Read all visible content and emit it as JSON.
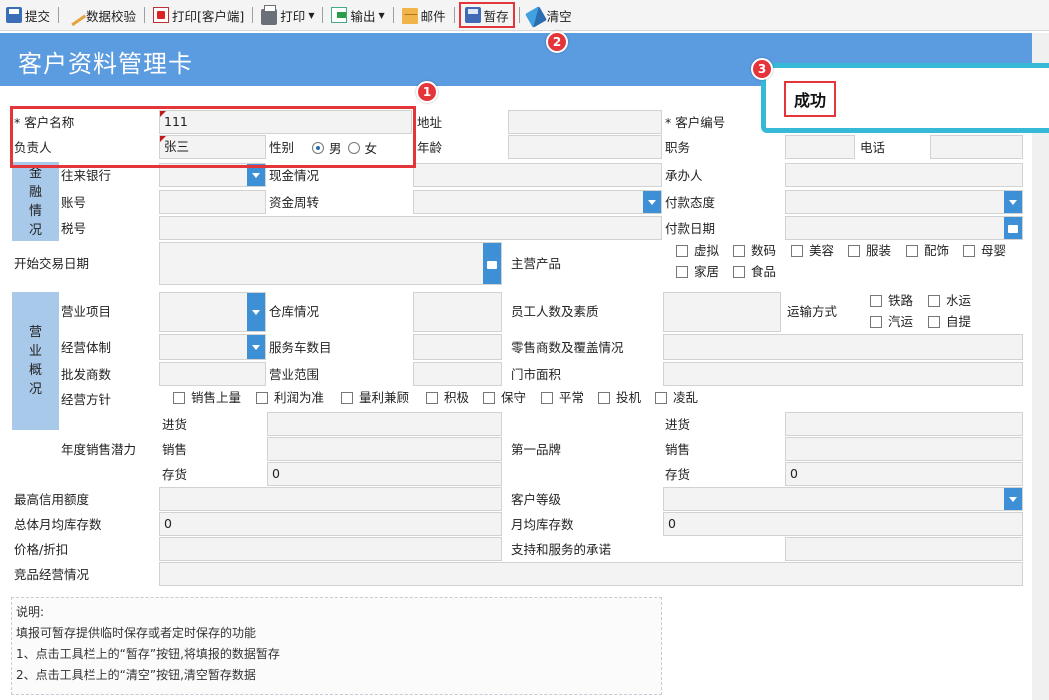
{
  "toolbar": {
    "submit": "提交",
    "validate": "数据校验",
    "print_client": "打印[客户端]",
    "print": "打印",
    "export": "输出",
    "mail": "邮件",
    "save_draft": "暂存",
    "clear": "清空"
  },
  "badges": {
    "one": "1",
    "two": "2",
    "three": "3"
  },
  "page_title": "客户资料管理卡",
  "popup": {
    "message": "成功"
  },
  "form": {
    "customer_name_label": "* 客户名称",
    "customer_name_value": "111",
    "address_label": "地址",
    "customer_code_label": "* 客户编号",
    "owner_label": "负责人",
    "owner_value": "张三",
    "gender_label": "性别",
    "gender_male": "男",
    "gender_female": "女",
    "age_label": "年龄",
    "position_label": "职务",
    "phone_label": "电话",
    "finance_section": "金融情况",
    "bank_label": "往来银行",
    "cash_label": "现金情况",
    "handler_label": "承办人",
    "account_label": "账号",
    "turnover_label": "资金周转",
    "payment_attitude_label": "付款态度",
    "tax_label": "税号",
    "payment_date_label": "付款日期",
    "start_date_label": "开始交易日期",
    "main_product_label": "主营产品",
    "products": [
      "虚拟",
      "数码",
      "美容",
      "服装",
      "配饰",
      "母婴",
      "家居",
      "食品"
    ],
    "business_section": "营业概况",
    "business_item_label": "营业项目",
    "warehouse_label": "仓库情况",
    "staff_label": "员工人数及素质",
    "transport_label": "运输方式",
    "transport": [
      "铁路",
      "水运",
      "汽运",
      "自提"
    ],
    "system_label": "经营体制",
    "vehicles_label": "服务车数目",
    "retailers_label": "零售商数及覆盖情况",
    "wholesalers_label": "批发商数",
    "scope_label": "营业范围",
    "store_area_label": "门市面积",
    "policy_label": "经营方针",
    "policies": [
      "销售上量",
      "利润为准",
      "量利兼顾",
      "积极",
      "保守",
      "平常",
      "投机",
      "凌乱"
    ],
    "annual_potential_label": "年度销售潜力",
    "purchase_label": "进货",
    "sales_label": "销售",
    "stock_label": "存货",
    "stock_value": "0",
    "first_brand_label": "第一品牌",
    "brand_purchase_label": "进货",
    "brand_sales_label": "销售",
    "brand_stock_label": "存货",
    "brand_stock_value": "0",
    "credit_limit_label": "最高信用额度",
    "customer_level_label": "客户等级",
    "avg_inventory_label": "总体月均库存数",
    "avg_inventory_value": "0",
    "monthly_inventory_label": "月均库存数",
    "monthly_inventory_value": "0",
    "price_discount_label": "价格/折扣",
    "support_label": "支持和服务的承诺",
    "competitor_label": "竞品经营情况"
  },
  "notes": {
    "title": "说明:",
    "line1": "填报可暂存提供临时保存或者定时保存的功能",
    "line2": "1、点击工具栏上的“暂存”按钮,将填报的数据暂存",
    "line3": "2、点击工具栏上的“清空”按钮,清空暂存数据"
  }
}
